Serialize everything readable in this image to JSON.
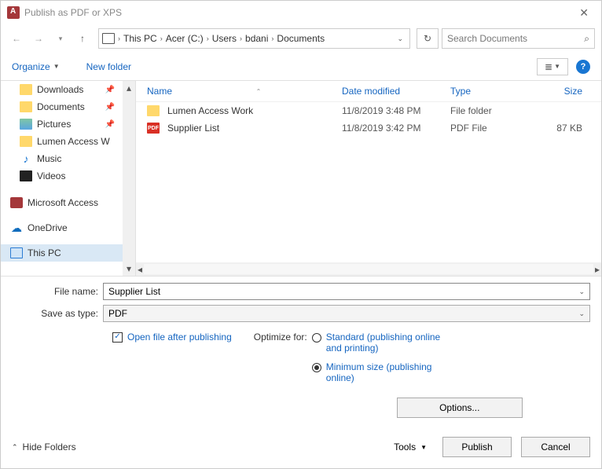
{
  "title": "Publish as PDF or XPS",
  "breadcrumbs": [
    "This PC",
    "Acer (C:)",
    "Users",
    "bdani",
    "Documents"
  ],
  "search_placeholder": "Search Documents",
  "toolbar": {
    "organize": "Organize",
    "new_folder": "New folder"
  },
  "sidebar": {
    "items": [
      {
        "label": "Downloads",
        "pinned": true
      },
      {
        "label": "Documents",
        "pinned": true
      },
      {
        "label": "Pictures",
        "pinned": true
      },
      {
        "label": "Lumen Access W",
        "pinned": false
      },
      {
        "label": "Music",
        "pinned": false
      },
      {
        "label": "Videos",
        "pinned": false
      }
    ],
    "group2": [
      {
        "label": "Microsoft Access"
      },
      {
        "label": "OneDrive"
      },
      {
        "label": "This PC"
      }
    ]
  },
  "columns": {
    "name": "Name",
    "date": "Date modified",
    "type": "Type",
    "size": "Size"
  },
  "files": [
    {
      "name": "Lumen Access Work",
      "date": "11/8/2019 3:48 PM",
      "type": "File folder",
      "size": "",
      "kind": "folder"
    },
    {
      "name": "Supplier List",
      "date": "11/8/2019 3:42 PM",
      "type": "PDF File",
      "size": "87 KB",
      "kind": "pdf"
    }
  ],
  "filename": {
    "label": "File name:",
    "value": "Supplier List"
  },
  "saveastype": {
    "label": "Save as type:",
    "value": "PDF"
  },
  "open_after": "Open file after publishing",
  "optimize_label": "Optimize for:",
  "radios": {
    "standard": "Standard (publishing online and printing)",
    "minimum": "Minimum size (publishing online)"
  },
  "options_btn": "Options...",
  "hide_folders": "Hide Folders",
  "tools": "Tools",
  "publish": "Publish",
  "cancel": "Cancel"
}
